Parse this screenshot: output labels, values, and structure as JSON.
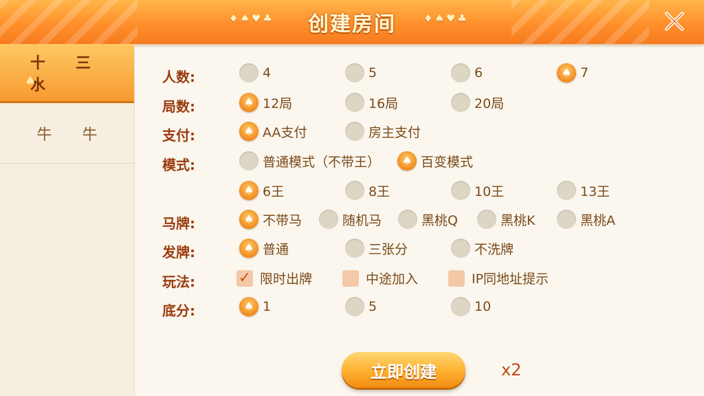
{
  "header": {
    "title": "创建房间",
    "suits_left": "♦♠♥♣",
    "suits_right": "♦♠♥♣"
  },
  "sidebar": {
    "tabs": [
      {
        "label": "十三水",
        "active": true
      },
      {
        "label": "牛牛",
        "active": false
      }
    ]
  },
  "settings": {
    "players": {
      "label": "人数:",
      "options": [
        "4",
        "5",
        "6",
        "7"
      ],
      "selected": "7"
    },
    "rounds": {
      "label": "局数:",
      "options": [
        "12局",
        "16局",
        "20局"
      ],
      "selected": "12局"
    },
    "payment": {
      "label": "支付:",
      "options": [
        "AA支付",
        "房主支付"
      ],
      "selected": "AA支付"
    },
    "mode": {
      "label": "模式:",
      "options": [
        "普通模式（不带王）",
        "百变模式"
      ],
      "selected": "百变模式"
    },
    "kings": {
      "options": [
        "6王",
        "8王",
        "10王",
        "13王"
      ],
      "selected": "6王"
    },
    "horse": {
      "label": "马牌:",
      "options": [
        "不带马",
        "随机马",
        "黑桃Q",
        "黑桃K",
        "黑桃A"
      ],
      "selected": "不带马"
    },
    "deal": {
      "label": "发牌:",
      "options": [
        "普通",
        "三张分",
        "不洗牌"
      ],
      "selected": "普通"
    },
    "rules": {
      "label": "玩法:",
      "options": [
        {
          "text": "限时出牌",
          "checked": true
        },
        {
          "text": "中途加入",
          "checked": false
        },
        {
          "text": "IP同地址提示",
          "checked": false
        }
      ]
    },
    "base_score": {
      "label": "底分:",
      "options": [
        "1",
        "5",
        "10"
      ],
      "selected": "1"
    }
  },
  "footer": {
    "create_label": "立即创建",
    "cost": "x2"
  },
  "colors": {
    "accent": "#f79a30",
    "label": "#9a3b0e",
    "text": "#7a4a1c"
  }
}
